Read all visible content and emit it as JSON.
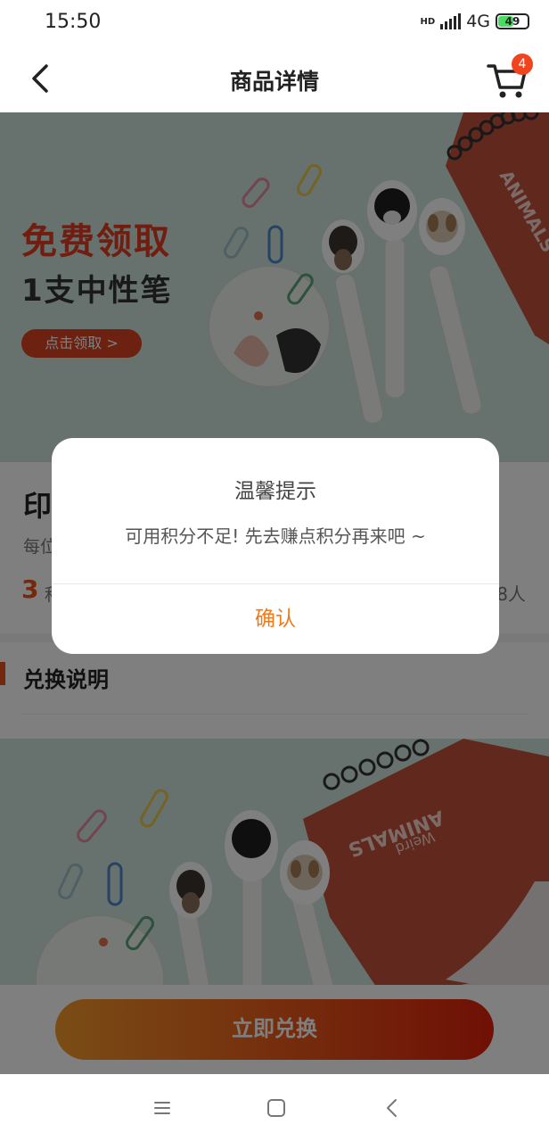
{
  "status_bar": {
    "time": "15:50",
    "network": "4G",
    "hd_label": "HD",
    "battery": "49"
  },
  "nav": {
    "title": "商品详情",
    "cart_badge": "4"
  },
  "banner": {
    "headline": "免费领取",
    "subheadline": "1支中性笔",
    "cta_label": "点击领取 >",
    "notebook_text": "ANIMALS"
  },
  "product": {
    "name_visible": "印",
    "desc_visible": "每位",
    "price": "3",
    "price_unit_visible": "积",
    "count_visible": "8人"
  },
  "section": {
    "title": "兑换说明"
  },
  "banner2": {
    "notebook_text": "ANIMALS",
    "notebook_subtext": "Weird"
  },
  "action": {
    "exchange_label": "立即兑换"
  },
  "dialog": {
    "title": "温馨提示",
    "message": "可用积分不足! 先去赚点积分再来吧 ~",
    "confirm_label": "确认"
  },
  "colors": {
    "accent": "#e8501d",
    "confirm": "#f07a1a",
    "badge": "#f2431f"
  }
}
